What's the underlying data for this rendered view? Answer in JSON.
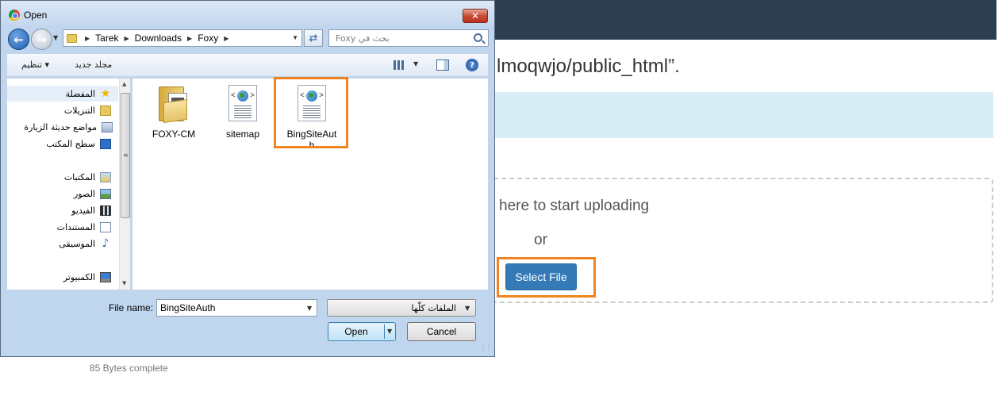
{
  "background": {
    "path_text": "lmoqwjo/public_html”.",
    "drop_text": "here to start uploading",
    "or_text": "or",
    "select_file_label": "Select File",
    "bytes_complete": "85 Bytes complete",
    "colors": {
      "topbar": "#2c3e50",
      "info_band": "#d9edf7",
      "button": "#337ab7",
      "highlight": "#f28420"
    }
  },
  "dialog": {
    "title": "Open",
    "title_icon": "chrome-icon",
    "close_label": "✕",
    "address": {
      "segments": [
        "Tarek",
        "Downloads",
        "Foxy"
      ]
    },
    "search_placeholder": "بحث في Foxy",
    "commands": {
      "organize": "تنظيم ▾",
      "new_folder": "مجلد جديد"
    },
    "nav_items": [
      {
        "label": "المفضلة",
        "icon": "star-icon"
      },
      {
        "label": "التنزيلات",
        "icon": "downloads-folder-icon"
      },
      {
        "label": "مواضع حديثة الزيارة",
        "icon": "recent-places-icon"
      },
      {
        "label": "سطح المكتب",
        "icon": "desktop-icon"
      },
      {
        "label": "المكتبات",
        "icon": "libraries-icon"
      },
      {
        "label": "الصور",
        "icon": "pictures-icon"
      },
      {
        "label": "الفيديو",
        "icon": "videos-icon"
      },
      {
        "label": "المستندات",
        "icon": "documents-icon"
      },
      {
        "label": "الموسيقى",
        "icon": "music-icon"
      },
      {
        "label": "الكمبيوتر",
        "icon": "computer-icon"
      }
    ],
    "files": [
      {
        "name": "FOXY-CM",
        "type": "folder"
      },
      {
        "name": "sitemap",
        "type": "html"
      },
      {
        "name": "BingSiteAuth",
        "name_line1": "BingSiteAut",
        "name_line2": "h",
        "type": "html"
      }
    ],
    "file_name_label": "File name:",
    "file_name_value": "BingSiteAuth",
    "file_type": "الملفات كلّها",
    "open_label": "Open",
    "cancel_label": "Cancel"
  }
}
